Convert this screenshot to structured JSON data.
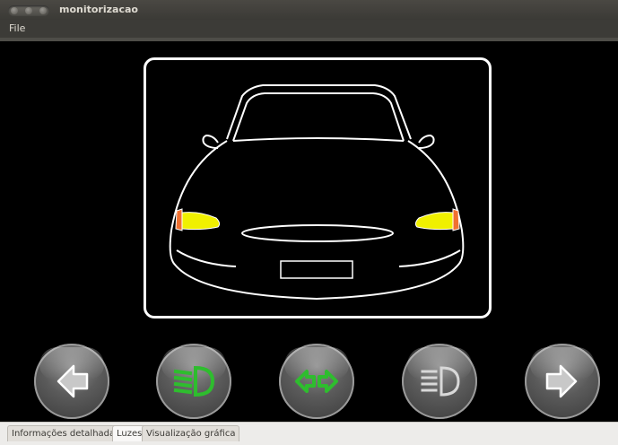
{
  "window": {
    "title": "monitorizacao"
  },
  "menubar": {
    "file": "File"
  },
  "buttons": [
    {
      "name": "left-turn-signal-button",
      "icon": "left-arrow-icon",
      "active": false
    },
    {
      "name": "low-beam-button",
      "icon": "low-beam-headlight-icon",
      "active": true,
      "active_color": "#2ebd2e"
    },
    {
      "name": "hazard-lights-button",
      "icon": "hazard-arrows-icon",
      "active": true,
      "active_color": "#2ebd2e"
    },
    {
      "name": "high-beam-button",
      "icon": "high-beam-headlight-icon",
      "active": false
    },
    {
      "name": "right-turn-signal-button",
      "icon": "right-arrow-icon",
      "active": false
    }
  ],
  "car": {
    "headlight_color": "#f0f000",
    "indicator_color": "#f07030"
  },
  "tabs": [
    {
      "label": "Informações detalhadas",
      "active": false
    },
    {
      "label": "Luzes",
      "active": true
    },
    {
      "label": "Visualização gráfica",
      "active": false
    }
  ]
}
